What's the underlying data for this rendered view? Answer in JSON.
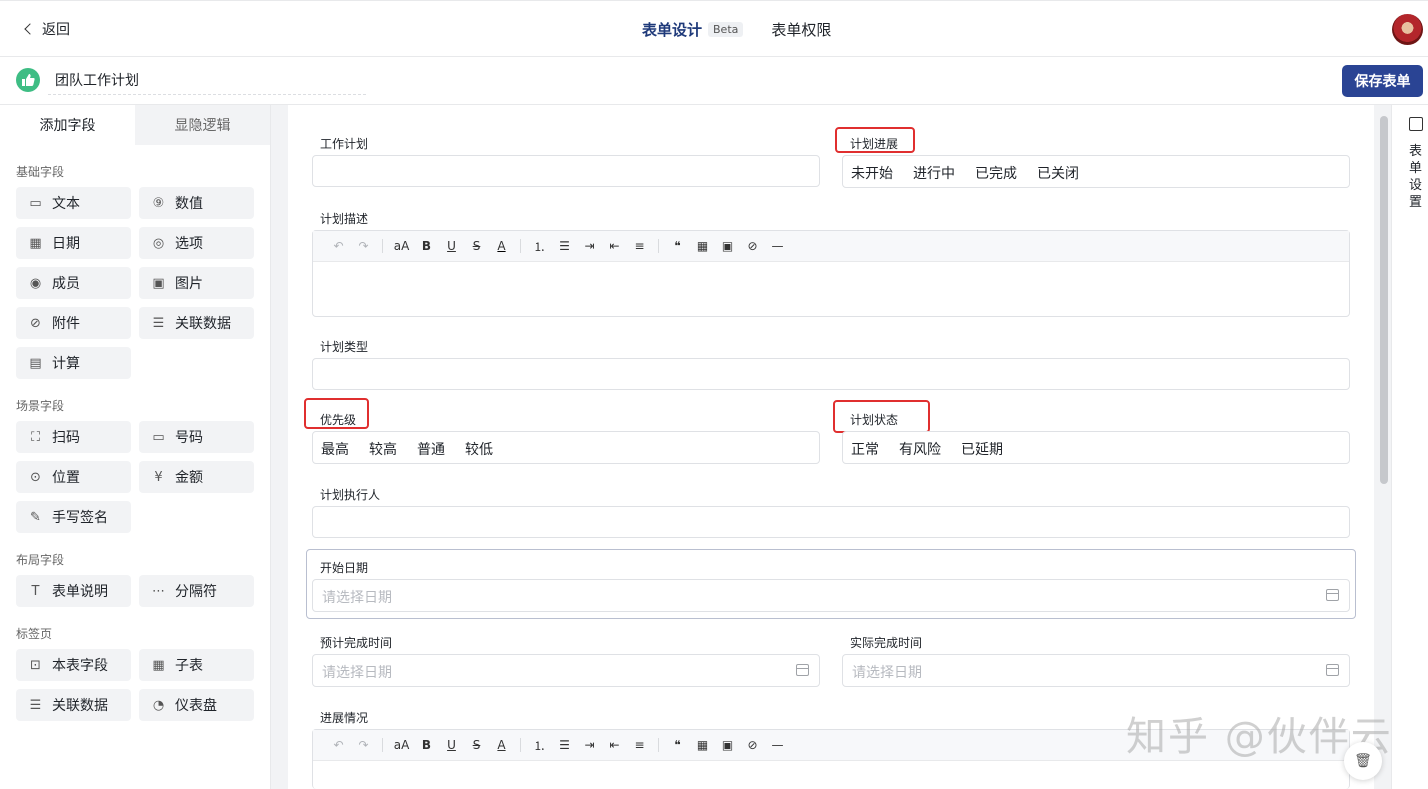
{
  "header": {
    "back_label": "返回",
    "tabs": [
      {
        "label": "表单设计",
        "badge": "Beta",
        "active": true
      },
      {
        "label": "表单权限",
        "active": false
      }
    ]
  },
  "titlebar": {
    "form_name": "团队工作计划",
    "save_label": "保存表单",
    "accent_color": "#2a4494"
  },
  "leftpanel": {
    "tabs": [
      "添加字段",
      "显隐逻辑"
    ],
    "groups": [
      {
        "title": "基础字段",
        "items": [
          {
            "label": "文本",
            "icon": "text-field-icon"
          },
          {
            "label": "数值",
            "icon": "number-icon"
          },
          {
            "label": "日期",
            "icon": "calendar-icon"
          },
          {
            "label": "选项",
            "icon": "option-icon"
          },
          {
            "label": "成员",
            "icon": "member-icon"
          },
          {
            "label": "图片",
            "icon": "image-icon"
          },
          {
            "label": "附件",
            "icon": "paperclip-icon"
          },
          {
            "label": "关联数据",
            "icon": "linked-data-icon"
          },
          {
            "label": "计算",
            "icon": "calculator-icon"
          }
        ]
      },
      {
        "title": "场景字段",
        "items": [
          {
            "label": "扫码",
            "icon": "scan-icon"
          },
          {
            "label": "号码",
            "icon": "number-tag-icon"
          },
          {
            "label": "位置",
            "icon": "location-icon"
          },
          {
            "label": "金额",
            "icon": "yen-icon"
          },
          {
            "label": "手写签名",
            "icon": "pen-icon"
          }
        ]
      },
      {
        "title": "布局字段",
        "items": [
          {
            "label": "表单说明",
            "icon": "text-t-icon"
          },
          {
            "label": "分隔符",
            "icon": "dots-icon"
          }
        ]
      },
      {
        "title": "标签页",
        "items": [
          {
            "label": "本表字段",
            "icon": "sub-field-icon"
          },
          {
            "label": "子表",
            "icon": "table-icon"
          },
          {
            "label": "关联数据",
            "icon": "linked-data-icon"
          },
          {
            "label": "仪表盘",
            "icon": "dashboard-icon"
          }
        ]
      }
    ]
  },
  "form": {
    "work_plan": {
      "label": "工作计划"
    },
    "progress": {
      "label": "计划进展",
      "options": [
        "未开始",
        "进行中",
        "已完成",
        "已关闭"
      ]
    },
    "description": {
      "label": "计划描述"
    },
    "plan_type": {
      "label": "计划类型"
    },
    "priority": {
      "label": "优先级",
      "options": [
        "最高",
        "较高",
        "普通",
        "较低"
      ]
    },
    "status": {
      "label": "计划状态",
      "options": [
        "正常",
        "有风险",
        "已延期"
      ]
    },
    "executor": {
      "label": "计划执行人"
    },
    "start_date": {
      "label": "开始日期",
      "placeholder": "请选择日期"
    },
    "planned_finish": {
      "label": "预计完成时间",
      "placeholder": "请选择日期"
    },
    "actual_finish": {
      "label": "实际完成时间",
      "placeholder": "请选择日期"
    },
    "progress_detail": {
      "label": "进展情况"
    }
  },
  "rightstrip": {
    "label": "表单设置"
  },
  "watermark": "知乎 @伙伴云",
  "highlight_color": "#e02f2f"
}
